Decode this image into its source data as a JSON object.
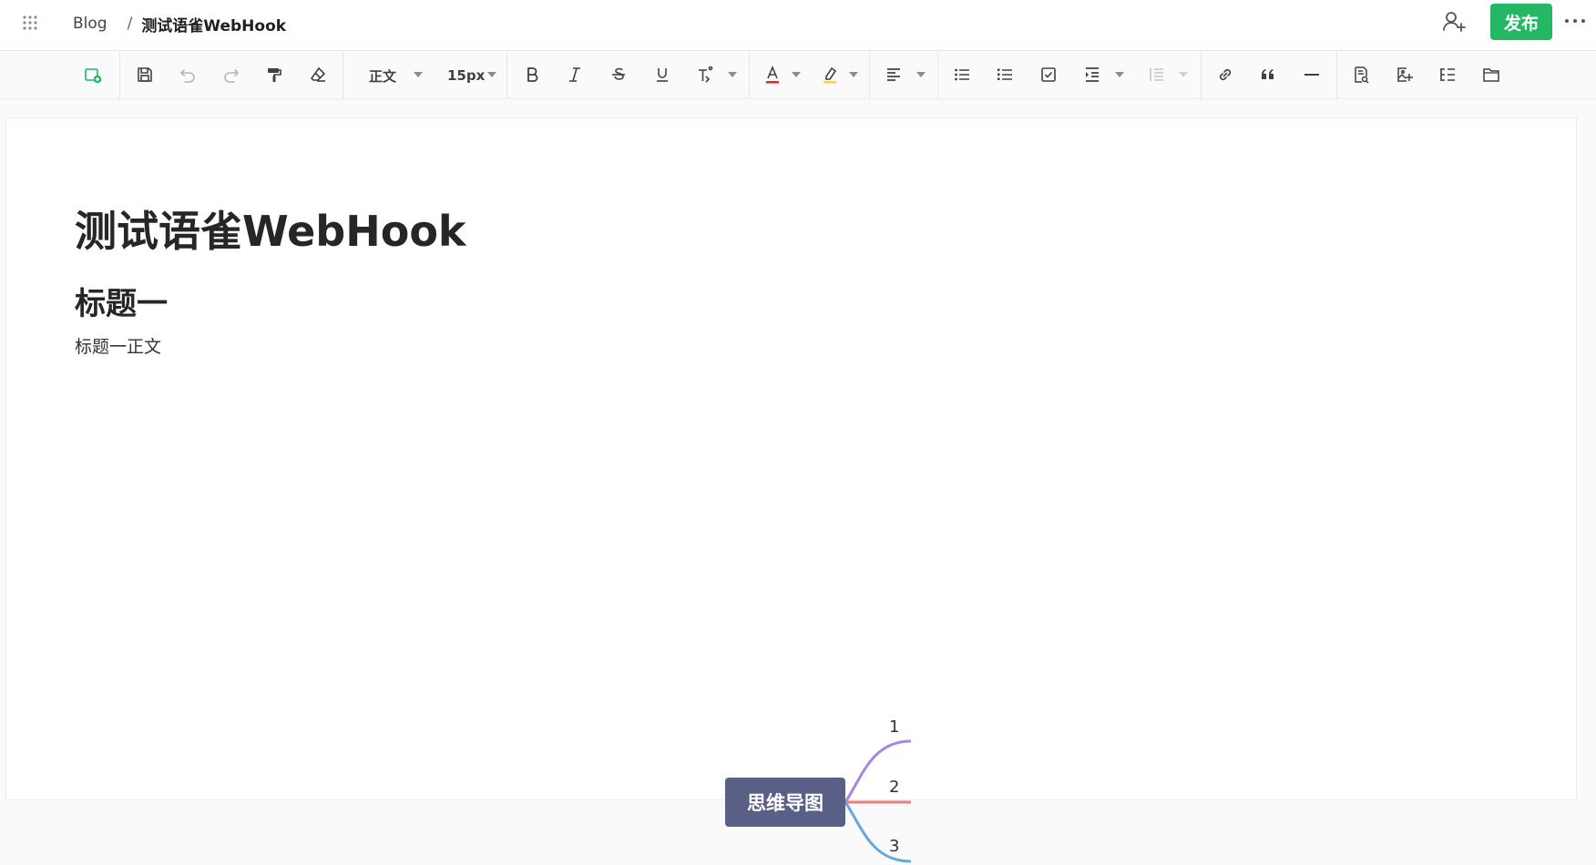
{
  "header": {
    "breadcrumb": {
      "book": "Blog",
      "separator": "/",
      "current": "测试语雀WebHook"
    },
    "publish_label": "发布",
    "icons": [
      "apps-grid-icon",
      "add-collaborator-icon",
      "more-icon"
    ],
    "accent": "#25b864"
  },
  "toolbar": {
    "paragraph_style": "正文",
    "font_size": "15px",
    "icons": [
      "insert-card-icon",
      "save-icon",
      "undo-icon",
      "redo-icon",
      "format-painter-icon",
      "clear-format-icon",
      "bold-icon",
      "italic-icon",
      "strikethrough-icon",
      "underline-icon",
      "superscript-icon",
      "font-color-icon",
      "highlight-icon",
      "align-icon",
      "bullet-list-icon",
      "ordered-list-icon",
      "task-list-icon",
      "indent-icon",
      "line-height-icon",
      "link-icon",
      "quote-icon",
      "divider-icon",
      "document-icon",
      "image-icon",
      "outline-icon",
      "folder-icon"
    ],
    "font_color": "#f5222d",
    "highlight_color": "#fadb14"
  },
  "document": {
    "title": "测试语雀WebHook",
    "heading1": "标题一",
    "paragraph": "标题一正文",
    "mindmap": {
      "root": "思维导图",
      "branches": [
        {
          "label": "1",
          "color": "#a687e0"
        },
        {
          "label": "2",
          "color": "#ea7d7d"
        },
        {
          "label": "3",
          "color": "#64a8dc"
        }
      ],
      "root_color": "#595f85"
    }
  }
}
